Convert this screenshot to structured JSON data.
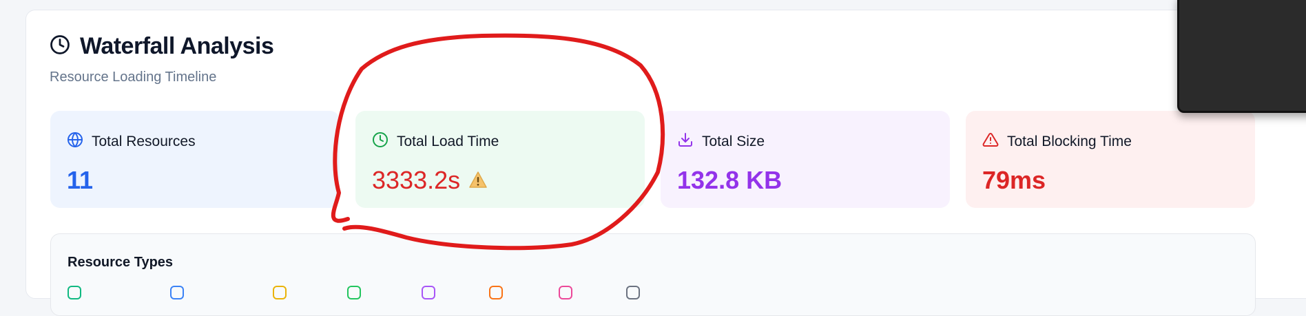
{
  "header": {
    "title": "Waterfall Analysis",
    "subtitle": "Resource Loading Timeline",
    "icon": "clock-icon"
  },
  "cards": [
    {
      "label": "Total Resources",
      "value": "11",
      "icon": "globe-icon",
      "color": "#2563eb"
    },
    {
      "label": "Total Load Time",
      "value": "3333.2s",
      "icon": "clock-icon",
      "color": "#dc2626",
      "warning_icon": "warning-icon"
    },
    {
      "label": "Total Size",
      "value": "132.8 KB",
      "icon": "download-icon",
      "color": "#9333ea"
    },
    {
      "label": "Total Blocking Time",
      "value": "79ms",
      "icon": "alert-triangle-icon",
      "color": "#dc2626"
    }
  ],
  "resource_types": {
    "label": "Resource Types",
    "legend_colors": [
      "#10b981",
      "#3b82f6",
      "#eab308",
      "#22c55e",
      "#a855f7",
      "#f97316",
      "#ec4899",
      "#6b7280"
    ]
  },
  "annotation": {
    "color": "#e01b1b",
    "shape": "hand-drawn circle around Total Load Time card"
  }
}
